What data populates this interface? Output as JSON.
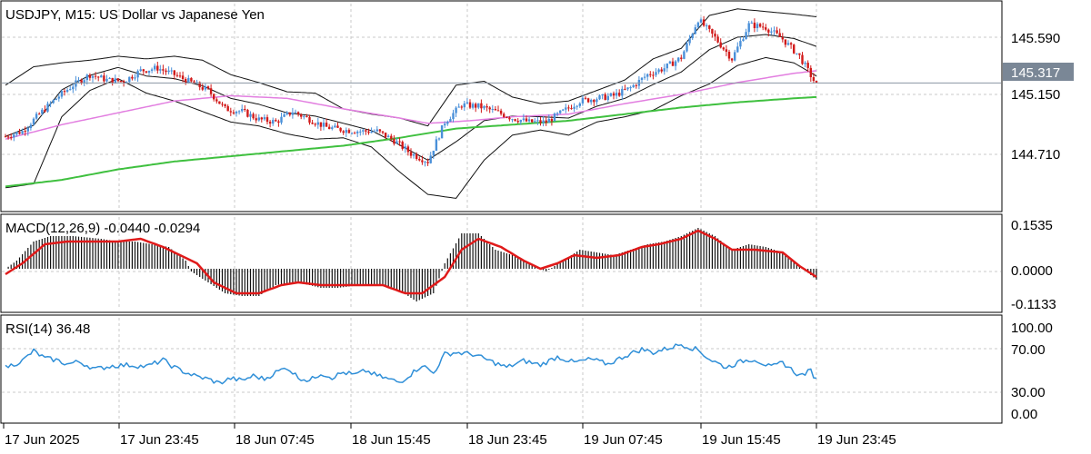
{
  "chart_data": {
    "type": "candlestick",
    "symbol": "USDJPY",
    "timeframe": "M15",
    "description": "US Dollar vs Japanese Yen",
    "header": "USDJPY, M15:  US Dollar vs Japanese Yen",
    "last_price": "145.317",
    "price_axis": {
      "ticks": [
        "145.590",
        "145.150",
        "144.710"
      ],
      "ylim": [
        144.36,
        145.92
      ]
    },
    "time_axis": {
      "labels": [
        "17 Jun 2025",
        "17 Jun 23:45",
        "18 Jun 07:45",
        "18 Jun 15:45",
        "18 Jun 23:45",
        "19 Jun 07:45",
        "19 Jun 15:45",
        "19 Jun 23:45"
      ]
    },
    "price_guide": [
      [
        0,
        144.91
      ],
      [
        6,
        144.95
      ],
      [
        12,
        145.08
      ],
      [
        18,
        145.2
      ],
      [
        24,
        145.3
      ],
      [
        30,
        145.38
      ],
      [
        36,
        145.34
      ],
      [
        42,
        145.33
      ],
      [
        48,
        145.41
      ],
      [
        54,
        145.43
      ],
      [
        60,
        145.38
      ],
      [
        66,
        145.32
      ],
      [
        72,
        145.26
      ],
      [
        78,
        145.12
      ],
      [
        84,
        145.1
      ],
      [
        90,
        145.04
      ],
      [
        96,
        145.02
      ],
      [
        102,
        145.1
      ],
      [
        108,
        145.04
      ],
      [
        114,
        144.98
      ],
      [
        120,
        144.96
      ],
      [
        126,
        144.95
      ],
      [
        132,
        144.95
      ],
      [
        138,
        144.88
      ],
      [
        144,
        144.78
      ],
      [
        150,
        144.72
      ],
      [
        156,
        145.02
      ],
      [
        162,
        145.15
      ],
      [
        168,
        145.14
      ],
      [
        174,
        145.1
      ],
      [
        180,
        145.05
      ],
      [
        186,
        145.02
      ],
      [
        192,
        145.02
      ],
      [
        198,
        145.1
      ],
      [
        204,
        145.18
      ],
      [
        210,
        145.2
      ],
      [
        216,
        145.22
      ],
      [
        222,
        145.28
      ],
      [
        228,
        145.38
      ],
      [
        234,
        145.43
      ],
      [
        240,
        145.51
      ],
      [
        246,
        145.8
      ],
      [
        252,
        145.66
      ],
      [
        258,
        145.5
      ],
      [
        264,
        145.76
      ],
      [
        270,
        145.74
      ],
      [
        276,
        145.65
      ],
      [
        282,
        145.52
      ],
      [
        288,
        145.3
      ]
    ],
    "bands": {
      "sma50": [
        [
          0,
          144.89
        ],
        [
          20,
          145.0
        ],
        [
          40,
          145.09
        ],
        [
          60,
          145.18
        ],
        [
          80,
          145.22
        ],
        [
          100,
          145.2
        ],
        [
          120,
          145.12
        ],
        [
          140,
          145.05
        ],
        [
          150,
          145.01
        ],
        [
          165,
          145.03
        ],
        [
          180,
          145.06
        ],
        [
          200,
          145.08
        ],
        [
          220,
          145.16
        ],
        [
          240,
          145.23
        ],
        [
          260,
          145.32
        ],
        [
          280,
          145.39
        ],
        [
          288,
          145.41
        ]
      ],
      "sma200": [
        [
          0,
          144.53
        ],
        [
          20,
          144.58
        ],
        [
          40,
          144.66
        ],
        [
          60,
          144.72
        ],
        [
          80,
          144.76
        ],
        [
          100,
          144.8
        ],
        [
          120,
          144.84
        ],
        [
          140,
          144.9
        ],
        [
          160,
          144.97
        ],
        [
          180,
          145.0
        ],
        [
          200,
          145.03
        ],
        [
          220,
          145.08
        ],
        [
          240,
          145.13
        ],
        [
          260,
          145.17
        ],
        [
          280,
          145.2
        ],
        [
          288,
          145.21
        ]
      ],
      "boll_upper": [
        [
          0,
          145.3
        ],
        [
          10,
          145.44
        ],
        [
          20,
          145.47
        ],
        [
          30,
          145.49
        ],
        [
          40,
          145.52
        ],
        [
          50,
          145.5
        ],
        [
          60,
          145.52
        ],
        [
          70,
          145.49
        ],
        [
          80,
          145.38
        ],
        [
          90,
          145.32
        ],
        [
          100,
          145.25
        ],
        [
          110,
          145.24
        ],
        [
          120,
          145.12
        ],
        [
          130,
          145.08
        ],
        [
          140,
          145.05
        ],
        [
          150,
          144.99
        ],
        [
          160,
          145.3
        ],
        [
          170,
          145.33
        ],
        [
          180,
          145.21
        ],
        [
          190,
          145.16
        ],
        [
          200,
          145.18
        ],
        [
          210,
          145.26
        ],
        [
          220,
          145.34
        ],
        [
          230,
          145.5
        ],
        [
          240,
          145.58
        ],
        [
          250,
          145.83
        ],
        [
          260,
          145.88
        ],
        [
          270,
          145.86
        ],
        [
          280,
          145.84
        ],
        [
          288,
          145.82
        ]
      ],
      "boll_lower": [
        [
          0,
          144.52
        ],
        [
          10,
          144.55
        ],
        [
          20,
          145.06
        ],
        [
          30,
          145.26
        ],
        [
          40,
          145.35
        ],
        [
          50,
          145.24
        ],
        [
          60,
          145.18
        ],
        [
          70,
          145.1
        ],
        [
          80,
          145.02
        ],
        [
          90,
          144.99
        ],
        [
          100,
          144.93
        ],
        [
          110,
          144.89
        ],
        [
          120,
          144.9
        ],
        [
          130,
          144.83
        ],
        [
          140,
          144.64
        ],
        [
          150,
          144.47
        ],
        [
          160,
          144.44
        ],
        [
          170,
          144.73
        ],
        [
          180,
          144.92
        ],
        [
          190,
          144.96
        ],
        [
          200,
          144.92
        ],
        [
          210,
          145.02
        ],
        [
          220,
          145.06
        ],
        [
          230,
          145.11
        ],
        [
          240,
          145.22
        ],
        [
          250,
          145.31
        ],
        [
          260,
          145.45
        ],
        [
          270,
          145.51
        ],
        [
          280,
          145.47
        ],
        [
          288,
          145.37
        ]
      ]
    },
    "macd": {
      "label": "MACD(12,26,9) -0.0440 -0.0294",
      "ticks": [
        "0.1535",
        "0.0000",
        "-0.1133"
      ],
      "ylim": [
        -0.15,
        0.19
      ],
      "hist_guide": [
        [
          0,
          0.0
        ],
        [
          4,
          0.03
        ],
        [
          10,
          0.1
        ],
        [
          16,
          0.12
        ],
        [
          24,
          0.12
        ],
        [
          34,
          0.11
        ],
        [
          40,
          0.1
        ],
        [
          46,
          0.1
        ],
        [
          52,
          0.09
        ],
        [
          58,
          0.08
        ],
        [
          64,
          0.03
        ],
        [
          66,
          -0.01
        ],
        [
          72,
          -0.05
        ],
        [
          78,
          -0.09
        ],
        [
          84,
          -0.1
        ],
        [
          90,
          -0.1
        ],
        [
          96,
          -0.06
        ],
        [
          102,
          -0.05
        ],
        [
          108,
          -0.06
        ],
        [
          112,
          -0.07
        ],
        [
          118,
          -0.07
        ],
        [
          126,
          -0.06
        ],
        [
          134,
          -0.06
        ],
        [
          140,
          -0.08
        ],
        [
          146,
          -0.12
        ],
        [
          152,
          -0.09
        ],
        [
          156,
          0.02
        ],
        [
          162,
          0.13
        ],
        [
          168,
          0.13
        ],
        [
          174,
          0.07
        ],
        [
          180,
          0.05
        ],
        [
          186,
          0.02
        ],
        [
          192,
          -0.01
        ],
        [
          198,
          0.03
        ],
        [
          204,
          0.07
        ],
        [
          210,
          0.06
        ],
        [
          216,
          0.05
        ],
        [
          222,
          0.07
        ],
        [
          228,
          0.09
        ],
        [
          234,
          0.1
        ],
        [
          240,
          0.12
        ],
        [
          246,
          0.15
        ],
        [
          252,
          0.12
        ],
        [
          258,
          0.07
        ],
        [
          264,
          0.09
        ],
        [
          270,
          0.08
        ],
        [
          276,
          0.06
        ],
        [
          282,
          0.01
        ],
        [
          288,
          -0.04
        ]
      ],
      "signal_guide": [
        [
          0,
          -0.02
        ],
        [
          6,
          0.02
        ],
        [
          14,
          0.09
        ],
        [
          22,
          0.1
        ],
        [
          30,
          0.1
        ],
        [
          40,
          0.1
        ],
        [
          48,
          0.11
        ],
        [
          56,
          0.08
        ],
        [
          62,
          0.05
        ],
        [
          68,
          0.02
        ],
        [
          74,
          -0.05
        ],
        [
          82,
          -0.09
        ],
        [
          90,
          -0.09
        ],
        [
          98,
          -0.06
        ],
        [
          104,
          -0.05
        ],
        [
          112,
          -0.06
        ],
        [
          120,
          -0.06
        ],
        [
          126,
          -0.06
        ],
        [
          134,
          -0.06
        ],
        [
          142,
          -0.09
        ],
        [
          148,
          -0.09
        ],
        [
          156,
          -0.03
        ],
        [
          162,
          0.07
        ],
        [
          168,
          0.11
        ],
        [
          176,
          0.08
        ],
        [
          184,
          0.03
        ],
        [
          190,
          0.0
        ],
        [
          196,
          0.02
        ],
        [
          202,
          0.05
        ],
        [
          210,
          0.04
        ],
        [
          218,
          0.05
        ],
        [
          226,
          0.08
        ],
        [
          232,
          0.09
        ],
        [
          240,
          0.11
        ],
        [
          246,
          0.14
        ],
        [
          252,
          0.11
        ],
        [
          258,
          0.07
        ],
        [
          266,
          0.07
        ],
        [
          276,
          0.06
        ],
        [
          282,
          0.01
        ],
        [
          288,
          -0.03
        ]
      ]
    },
    "rsi": {
      "label": "RSI(14) 36.48",
      "ticks": [
        "100.00",
        "70.00",
        "30.00",
        "0.00"
      ],
      "ylim": [
        -12,
        112
      ],
      "levels": [
        70,
        30
      ],
      "guide": [
        [
          0,
          52
        ],
        [
          6,
          60
        ],
        [
          10,
          72
        ],
        [
          14,
          63
        ],
        [
          18,
          61
        ],
        [
          22,
          56
        ],
        [
          26,
          59
        ],
        [
          32,
          50
        ],
        [
          38,
          54
        ],
        [
          44,
          55
        ],
        [
          50,
          53
        ],
        [
          56,
          61
        ],
        [
          60,
          52
        ],
        [
          64,
          46
        ],
        [
          68,
          41
        ],
        [
          72,
          38
        ],
        [
          76,
          33
        ],
        [
          80,
          39
        ],
        [
          84,
          36
        ],
        [
          88,
          42
        ],
        [
          92,
          38
        ],
        [
          96,
          46
        ],
        [
          100,
          52
        ],
        [
          104,
          40
        ],
        [
          108,
          36
        ],
        [
          112,
          45
        ],
        [
          116,
          40
        ],
        [
          120,
          46
        ],
        [
          124,
          43
        ],
        [
          128,
          48
        ],
        [
          132,
          42
        ],
        [
          136,
          38
        ],
        [
          140,
          34
        ],
        [
          144,
          44
        ],
        [
          148,
          55
        ],
        [
          152,
          45
        ],
        [
          156,
          68
        ],
        [
          160,
          70
        ],
        [
          166,
          68
        ],
        [
          172,
          60
        ],
        [
          178,
          52
        ],
        [
          184,
          60
        ],
        [
          190,
          55
        ],
        [
          196,
          65
        ],
        [
          202,
          58
        ],
        [
          208,
          62
        ],
        [
          214,
          56
        ],
        [
          220,
          66
        ],
        [
          226,
          74
        ],
        [
          230,
          70
        ],
        [
          236,
          76
        ],
        [
          240,
          80
        ],
        [
          246,
          73
        ],
        [
          250,
          62
        ],
        [
          256,
          52
        ],
        [
          262,
          60
        ],
        [
          266,
          62
        ],
        [
          272,
          52
        ],
        [
          276,
          58
        ],
        [
          282,
          42
        ],
        [
          286,
          48
        ],
        [
          288,
          37
        ]
      ]
    }
  },
  "colors": {
    "bull_candle": "#4a90d9",
    "bear_candle": "#d11a1a",
    "sma50": "#e27ee0",
    "sma200": "#3fc03f",
    "bollinger": "#111111",
    "macd_hist": "#111111",
    "macd_signal": "#e01a1a",
    "rsi_line": "#2f8fd8",
    "last_price_bg": "#7a8796",
    "grid": "#c8c8c8"
  }
}
